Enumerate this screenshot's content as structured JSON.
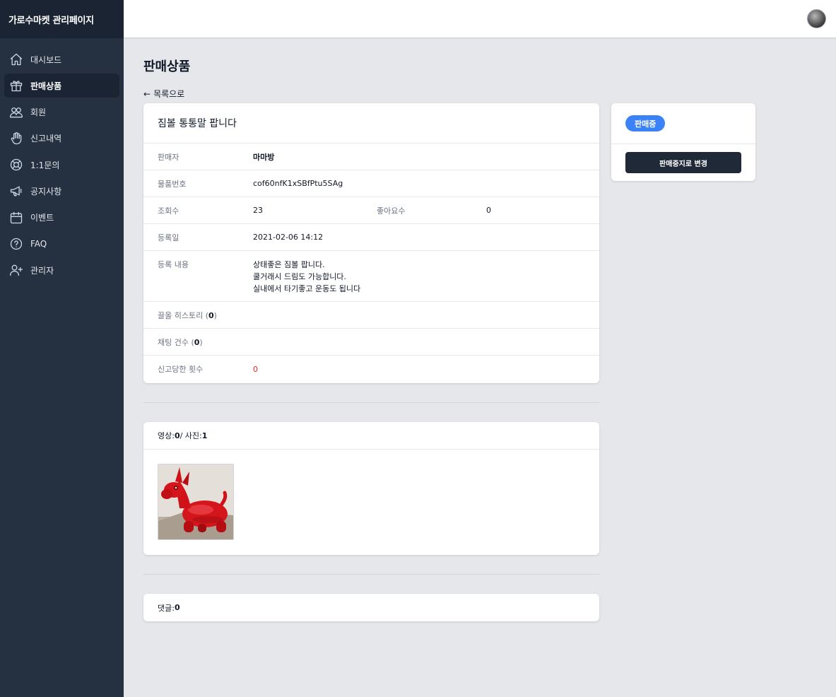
{
  "brand": {
    "title": "가로수마켓 관리페이지"
  },
  "sidebar": {
    "items": [
      {
        "label": "대시보드",
        "icon": "home-icon",
        "active": false
      },
      {
        "label": "판매상품",
        "icon": "gift-icon",
        "active": true
      },
      {
        "label": "회원",
        "icon": "users-icon",
        "active": false
      },
      {
        "label": "신고내역",
        "icon": "hand-icon",
        "active": false
      },
      {
        "label": "1:1문의",
        "icon": "lifebuoy-icon",
        "active": false
      },
      {
        "label": "공지사항",
        "icon": "megaphone-icon",
        "active": false
      },
      {
        "label": "이벤트",
        "icon": "calendar-icon",
        "active": false
      },
      {
        "label": "FAQ",
        "icon": "question-icon",
        "active": false
      },
      {
        "label": "관리자",
        "icon": "user-add-icon",
        "active": false
      }
    ]
  },
  "header": {
    "avatar_icon": "user-avatar"
  },
  "page": {
    "title": "판매상품",
    "back_label": "목록으로",
    "back_arrow": "←"
  },
  "detail": {
    "title": "짐볼 통통말 팝니다",
    "seller_label": "판매자",
    "seller_value": "마마방",
    "item_no_label": "물품번호",
    "item_no_value": "cof60nfK1xSBfPtu5SAg",
    "views_label": "조회수",
    "views_value": "23",
    "likes_label": "좋아요수",
    "likes_value": "0",
    "date_label": "등록일",
    "date_value": "2021-02-06 14:12",
    "content_label": "등록 내용",
    "content_lines": [
      "상태좋은 짐볼 팝니다.",
      "쿨거래시 드림도 가능합니다.",
      "실내에서 타기좋고 운동도 됩니다"
    ],
    "bump_label": "끌올 히스토리 (",
    "bump_count": "0",
    "bump_close": ")",
    "chat_label": "채팅 건수 (",
    "chat_count": "0",
    "chat_close": ")",
    "report_label": "신고당한 횟수",
    "report_value": "0"
  },
  "media": {
    "video_label": "영상: ",
    "video_count": "0",
    "sep": " / 사진: ",
    "photo_count": "1"
  },
  "comments": {
    "label": "댓글: ",
    "count": "0"
  },
  "status": {
    "badge": "판매중",
    "button": "판매중지로 변경",
    "badge_color": "#3b82f6",
    "button_color": "#1f2937"
  }
}
